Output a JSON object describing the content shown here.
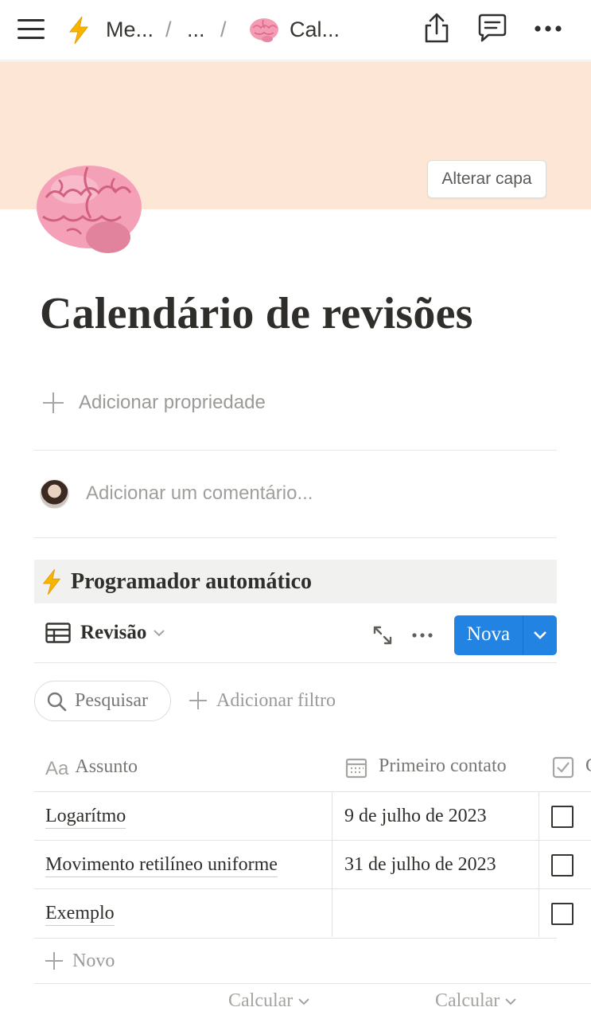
{
  "topbar": {
    "crumb1_icon": "lightning-emoji",
    "crumb1": "Me...",
    "sep": "/",
    "crumb2": "...",
    "crumb3_icon": "brain-emoji",
    "crumb3": "Cal...",
    "icons": [
      "menu-icon",
      "share-icon",
      "comment-icon",
      "more-icon"
    ]
  },
  "cover": {
    "color": "#fde6d6",
    "change_cover": "Alterar capa"
  },
  "page": {
    "icon": "brain-emoji",
    "title": "Calendário de revisões",
    "add_property": "Adicionar propriedade",
    "comment_placeholder": "Adicionar um comentário..."
  },
  "database": {
    "icon": "lightning-emoji",
    "title": "Programador automático",
    "view_label": "Revisão",
    "new_button": "Nova",
    "accent": "#2383e2",
    "search_label": "Pesquisar",
    "add_filter": "Adicionar filtro",
    "columns": [
      {
        "icon": "text-type-icon",
        "icon_text": "Aa",
        "label": "Assunto"
      },
      {
        "icon": "calendar-icon",
        "label": "Primeiro contato"
      },
      {
        "icon": "checkbox-icon",
        "label": "C"
      }
    ],
    "rows": [
      {
        "assunto": "Logarítmo",
        "primeiro_contato": "9 de julho de 2023",
        "checked": false
      },
      {
        "assunto": "Movimento retilíneo uniforme",
        "primeiro_contato": "31 de julho de 2023",
        "checked": false
      },
      {
        "assunto": "Exemplo",
        "primeiro_contato": "",
        "checked": false
      }
    ],
    "new_row": "Novo",
    "calc_labels": [
      "Calcular",
      "Calcular"
    ]
  }
}
